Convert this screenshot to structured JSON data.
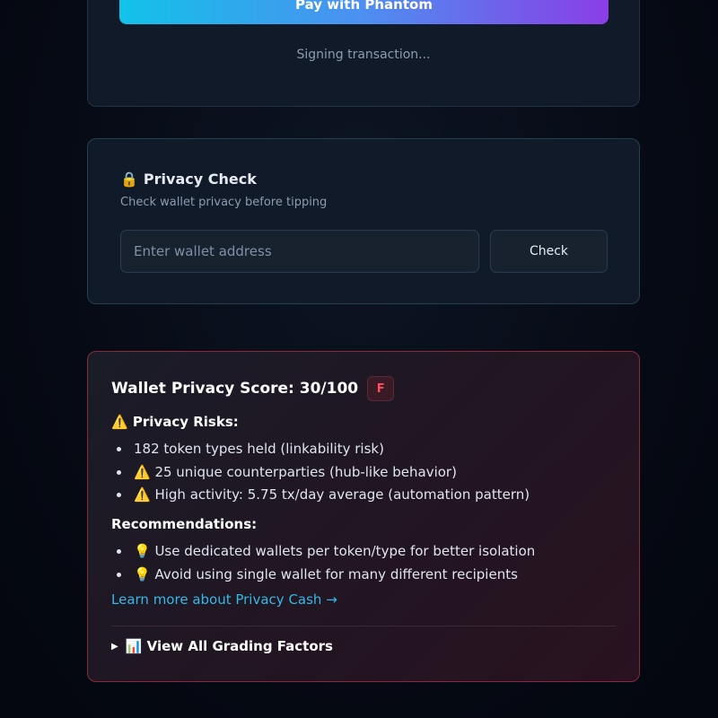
{
  "payment": {
    "pay_button_label": "Pay with Phantom",
    "status_text": "Signing transaction..."
  },
  "privacy_check": {
    "icon": "lock-icon",
    "title": "Privacy Check",
    "subtitle": "Check wallet privacy before tipping",
    "input_value": "",
    "input_placeholder": "Enter wallet address",
    "check_button_label": "Check"
  },
  "score": {
    "title": "Wallet Privacy Score: 30/100",
    "grade": "F",
    "risks_heading": "⚠️ Privacy Risks:",
    "risks": [
      "182 token types held (linkability risk)",
      "⚠️ 25 unique counterparties (hub-like behavior)",
      "⚠️ High activity: 5.75 tx/day average (automation pattern)"
    ],
    "recommendations_heading": "Recommendations:",
    "recommendations": [
      "💡 Use dedicated wallets per token/type for better isolation",
      "💡 Avoid using single wallet for many different recipients"
    ],
    "learn_more_link": "Learn more about Privacy Cash →",
    "factors_toggle_label": "📊 View All Grading Factors"
  },
  "colors": {
    "grade_badge_text": "#ff4d5e",
    "link": "#34b8e8",
    "score_card_border": "#8a2a38",
    "pay_gradient_start": "#12c2e9",
    "pay_gradient_end": "#8a3ee6"
  }
}
